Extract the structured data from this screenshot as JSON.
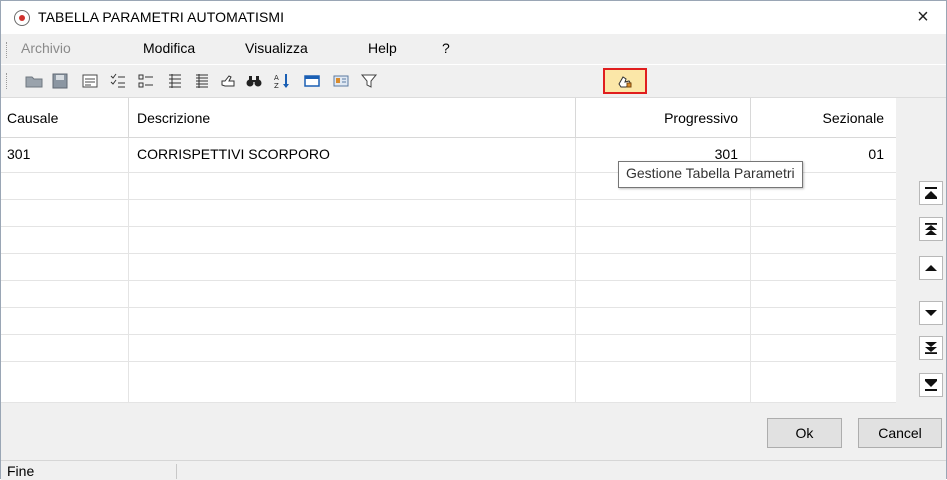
{
  "window": {
    "title": "TABELLA PARAMETRI AUTOMATISMI",
    "close_glyph": "×"
  },
  "menu": {
    "items": [
      {
        "label": "Archivio",
        "enabled": false
      },
      {
        "label": "Modifica",
        "enabled": true
      },
      {
        "label": "Visualizza",
        "enabled": true
      },
      {
        "label": "Help",
        "enabled": true
      },
      {
        "label": "?",
        "enabled": true
      }
    ]
  },
  "toolbar": {
    "icons": [
      "open-folder-icon",
      "save-icon",
      "form-view-icon",
      "checklist-icon",
      "list-view-icon",
      "tree-list-icon",
      "detail-list-icon",
      "hand-icon",
      "binoculars-icon",
      "sort-az-icon",
      "grid-icon",
      "card-icon",
      "filter-icon",
      "parameters-table-icon"
    ],
    "highlighted": "parameters-table-icon"
  },
  "table": {
    "columns": [
      "Causale",
      "Descrizione",
      "Progressivo",
      "Sezionale"
    ],
    "rows": [
      {
        "causale": "301",
        "descrizione": "CORRISPETTIVI SCORPORO",
        "progressivo": "301",
        "sezionale": "01"
      }
    ]
  },
  "tooltip": {
    "text": "Gestione Tabella Parametri"
  },
  "buttons": {
    "ok": "Ok",
    "cancel": "Cancel"
  },
  "status": {
    "text": "Fine"
  },
  "colors": {
    "highlight_border": "#e01e1e",
    "panel_bg": "#f0f0f0"
  }
}
